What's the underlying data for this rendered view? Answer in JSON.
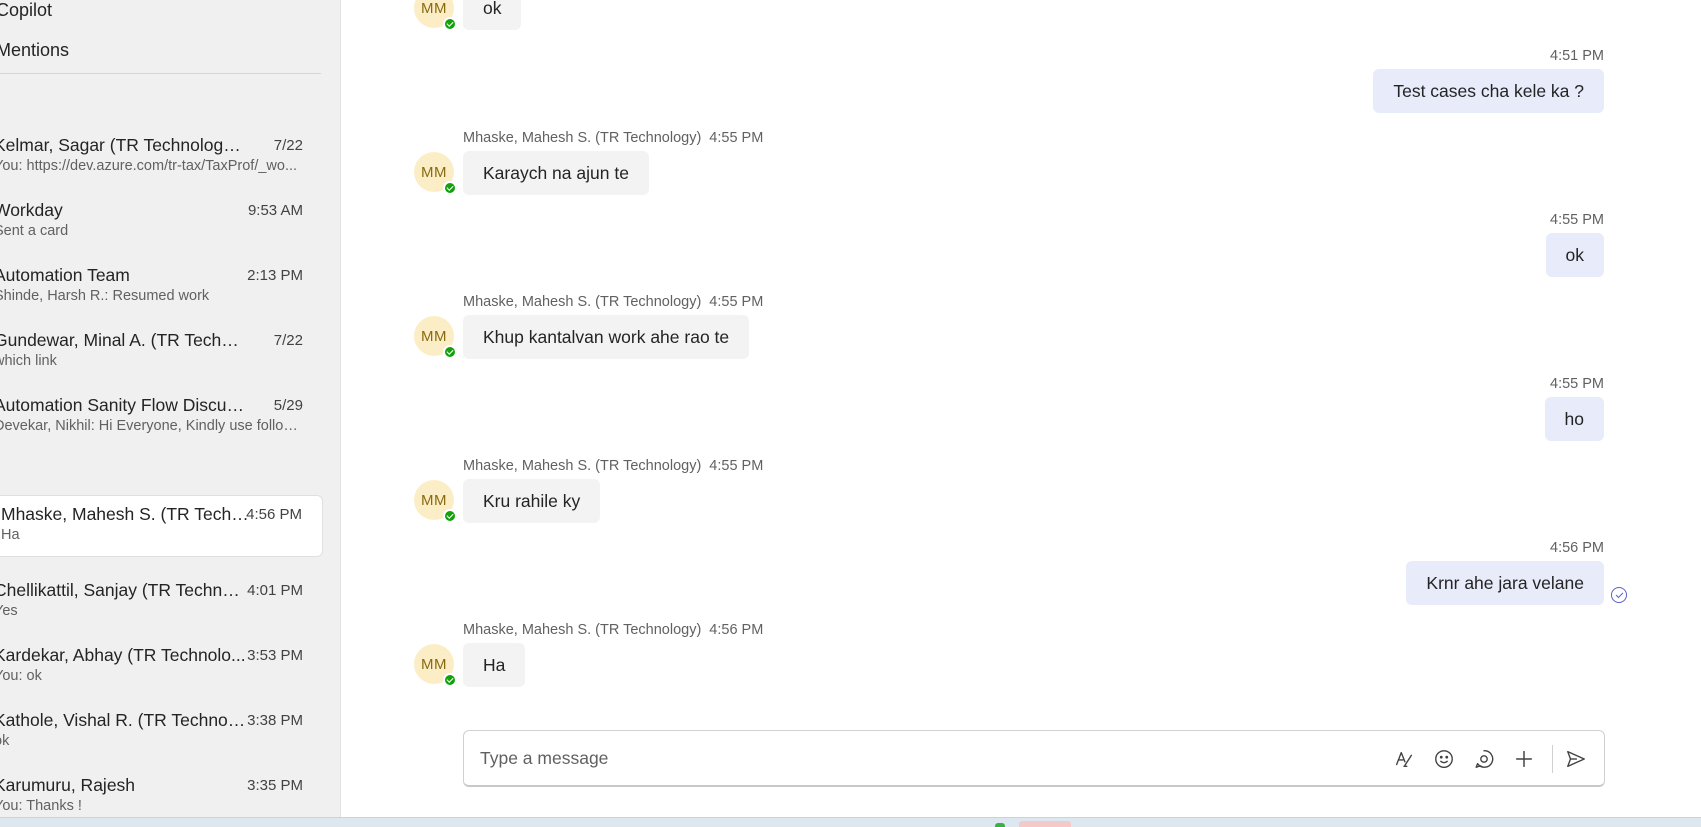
{
  "sidebar": {
    "nav": [
      {
        "label": "Copilot"
      },
      {
        "label": "Mentions"
      }
    ],
    "chats": [
      {
        "name": "Kelmar, Sagar (TR Technology) (You)",
        "time": "7/22",
        "preview": "You: https://dev.azure.com/tr-tax/TaxProf/_wo..."
      },
      {
        "name": "Workday",
        "time": "9:53 AM",
        "preview": "Sent a card"
      },
      {
        "name": "Automation Team",
        "time": "2:13 PM",
        "preview": "Shinde, Harsh R.: Resumed work"
      },
      {
        "name": "Gundewar, Minal A. (TR Technolo...",
        "time": "7/22",
        "preview": "which link"
      },
      {
        "name": "Automation Sanity Flow Discussion",
        "time": "5/29",
        "preview": "Devekar, Nikhil: Hi Everyone, Kindly use follow..."
      },
      {
        "name": "Mhaske, Mahesh S. (TR Techno...",
        "time": "4:56 PM",
        "preview": "Ha"
      },
      {
        "name": "Chellikattil, Sanjay (TR Technol...",
        "time": "4:01 PM",
        "preview": "Yes"
      },
      {
        "name": "Kardekar, Abhay (TR Technolo...",
        "time": "3:53 PM",
        "preview": "You: ok"
      },
      {
        "name": "Kathole, Vishal R. (TR Technolo...",
        "time": "3:38 PM",
        "preview": "ok"
      },
      {
        "name": "Karumuru, Rajesh",
        "time": "3:35 PM",
        "preview": "You: Thanks !"
      }
    ]
  },
  "conversation": {
    "avatar_initials": "MM",
    "messages": [
      {
        "dir": "in",
        "sender": "",
        "time": "",
        "text": "ok"
      },
      {
        "dir": "out",
        "time": "4:51 PM",
        "text": "Test cases cha kele ka ?"
      },
      {
        "dir": "in",
        "sender": "Mhaske, Mahesh S. (TR Technology)",
        "time": "4:55 PM",
        "text": "Karaych na ajun te"
      },
      {
        "dir": "out",
        "time": "4:55 PM",
        "text": "ok"
      },
      {
        "dir": "in",
        "sender": "Mhaske, Mahesh S. (TR Technology)",
        "time": "4:55 PM",
        "text": "Khup kantalvan work ahe rao te"
      },
      {
        "dir": "out",
        "time": "4:55 PM",
        "text": "ho"
      },
      {
        "dir": "in",
        "sender": "Mhaske, Mahesh S. (TR Technology)",
        "time": "4:55 PM",
        "text": "Kru rahile ky"
      },
      {
        "dir": "out",
        "time": "4:56 PM",
        "text": "Krnr ahe jara velane"
      },
      {
        "dir": "in",
        "sender": "Mhaske, Mahesh S. (TR Technology)",
        "time": "4:56 PM",
        "text": "Ha"
      }
    ]
  },
  "composer": {
    "placeholder": "Type a message",
    "tools": [
      "format-icon",
      "emoji-icon",
      "loop-icon",
      "attach-plus-icon",
      "send-icon"
    ]
  },
  "colors": {
    "accent": "#5b5fc7",
    "incoming_bubble": "#f3f3f3",
    "outgoing_bubble": "#e8ebfa",
    "presence": "#13a10e",
    "avatar_bg": "#fbeec6"
  }
}
